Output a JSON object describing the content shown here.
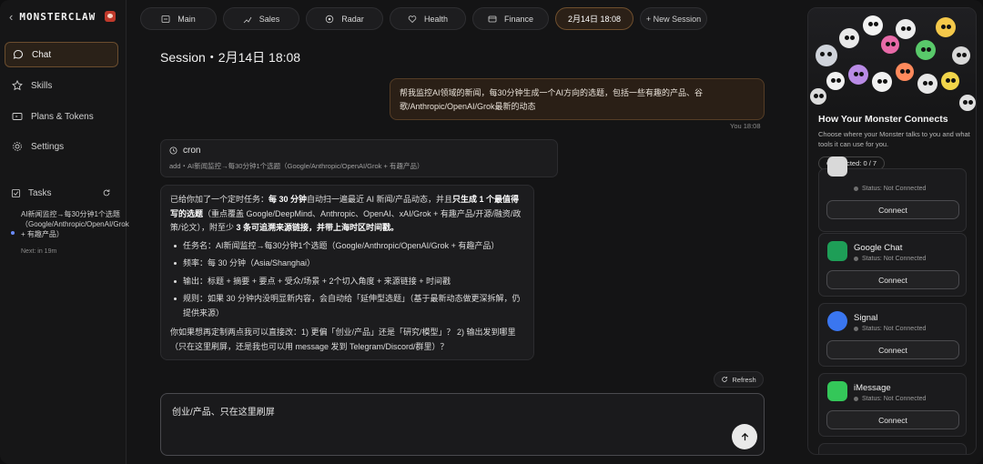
{
  "brand": {
    "name": "MONSTERCLAW"
  },
  "sidebar": {
    "items": [
      {
        "label": "Chat"
      },
      {
        "label": "Skills"
      },
      {
        "label": "Plans & Tokens"
      },
      {
        "label": "Settings"
      }
    ],
    "tasks": {
      "label": "Tasks",
      "items": [
        {
          "title": "AI新闻监控→每30分钟1个选题（Google/Anthropic/OpenAI/Grok + 有趣产品）",
          "next": "Next: in 19m"
        }
      ]
    }
  },
  "tabs": [
    {
      "label": "Main",
      "icon": "grid-icon"
    },
    {
      "label": "Sales",
      "icon": "chart-icon"
    },
    {
      "label": "Radar",
      "icon": "target-icon"
    },
    {
      "label": "Health",
      "icon": "heart-icon"
    },
    {
      "label": "Finance",
      "icon": "card-icon"
    },
    {
      "label": "2月14日 18:08",
      "active": true
    },
    {
      "label": "+ New Session"
    }
  ],
  "session": {
    "title": "Session・2月14日 18:08",
    "user_message": "帮我监控AI领域的新闻，每30分钟生成一个AI方向的选题，包括一些有趣的产品、谷歌/Anthropic/OpenAI/Grok最新的动态",
    "user_meta": "You 18:08",
    "tool": {
      "name": "cron",
      "detail": "add・AI新闻监控→每30分钟1个选题（Google/Anthropic/OpenAI/Grok + 有趣产品）"
    },
    "assistant": {
      "intro_a": "已给你加了一个定时任务：",
      "intro_b": "每 30 分钟",
      "intro_c": "自动扫一遍最近 AI 新闻/产品动态，并且",
      "intro_d": "只生成 1 个最值得写的选题",
      "intro_e": "（重点覆盖 Google/DeepMind、Anthropic、OpenAI、xAI/Grok + 有趣产品/开源/融资/政策/论文），附至少",
      "intro_f": "3 条可追溯来源链接",
      "intro_g": "，并带上海时区时间戳。",
      "bullets": [
        "任务名：AI新闻监控→每30分钟1个选题（Google/Anthropic/OpenAI/Grok + 有趣产品）",
        "频率：每 30 分钟（Asia/Shanghai）",
        "输出：标题 + 摘要 + 要点 + 受众/场景 + 2个切入角度 + 来源链接 + 时间戳",
        "规则：如果 30 分钟内没明显新内容，会自动给「延伸型选题」（基于最新动态做更深拆解，仍提供来源）"
      ],
      "tail": "你如果想再定制两点我可以直接改：1) 更偏「创业/产品」还是「研究/模型」？ 2) 输出发到哪里（只在这里刷屏，还是我也可以用 message 发到 Telegram/Discord/群里）？"
    },
    "refresh_label": "Refresh",
    "composer_value": "创业/产品、只在这里刷屏"
  },
  "panel": {
    "title": "How Your Monster Connects",
    "description": "Choose where your Monster talks to you and what tools it can use for you.",
    "connected": "Connected: 0 / 7",
    "services": [
      {
        "name": "",
        "status": "Status: Not Connected",
        "button": "Connect",
        "color": "#d9d9d9"
      },
      {
        "name": "Google Chat",
        "status": "Status: Not Connected",
        "button": "Connect",
        "color": "#1e9e57"
      },
      {
        "name": "Signal",
        "status": "Status: Not Connected",
        "button": "Connect",
        "color": "#3a76f0"
      },
      {
        "name": "iMessage",
        "status": "Status: Not Connected",
        "button": "Connect",
        "color": "#34c759"
      }
    ]
  },
  "colors": {
    "accent": "#6b4d2e",
    "background": "#141415"
  }
}
